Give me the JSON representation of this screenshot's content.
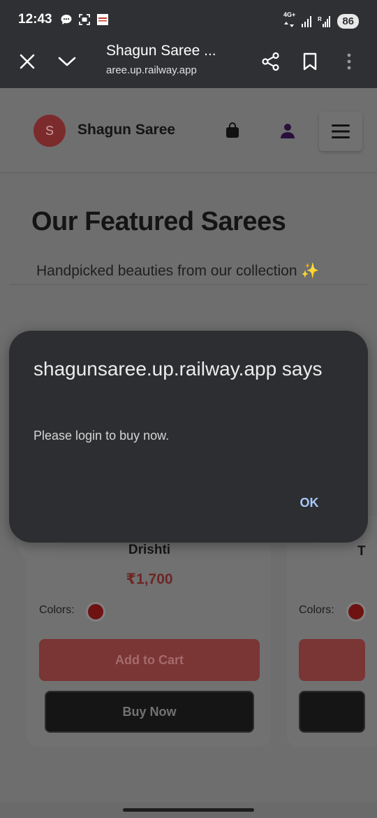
{
  "status_bar": {
    "time": "12:43",
    "network": "4G+",
    "battery": "86"
  },
  "browser": {
    "title": "Shagun Saree ...",
    "url": "aree.up.railway.app"
  },
  "site": {
    "logo_letter": "S",
    "name": "Shagun Saree"
  },
  "featured": {
    "title": "Our Featured Sarees",
    "subtitle": "Handpicked beauties from our collection ✨"
  },
  "products": [
    {
      "name": "Drishti",
      "price": "₹1,700",
      "colors_label": "Colors:",
      "color": "#6e1212",
      "add_to_cart": "Add to Cart",
      "buy_now": "Buy Now"
    },
    {
      "name": "T",
      "colors_label": "Colors:",
      "color": "#6e1212"
    }
  ],
  "dialog": {
    "title": "shagunsaree.up.railway.app says",
    "message": "Please login to buy now.",
    "ok_label": "OK"
  }
}
